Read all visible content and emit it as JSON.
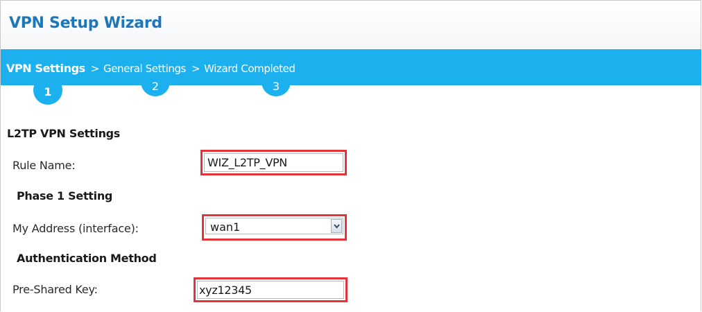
{
  "wizard": {
    "title": "VPN Setup Wizard"
  },
  "steps": {
    "items": [
      {
        "label": "VPN Settings",
        "number": "1",
        "active": true
      },
      {
        "label": "General Settings",
        "number": "2",
        "active": false
      },
      {
        "label": "Wizard Completed",
        "number": "3",
        "active": false
      }
    ],
    "separator": ">"
  },
  "form": {
    "section_title": "L2TP VPN Settings",
    "rule_name": {
      "label": "Rule Name:",
      "value": "WIZ_L2TP_VPN"
    },
    "phase1": {
      "title": "Phase 1 Setting",
      "my_address": {
        "label": "My Address (interface):",
        "value": "wan1"
      }
    },
    "authentication": {
      "title": "Authentication Method",
      "pre_shared_key": {
        "label": "Pre-Shared Key:",
        "value": "xyz12345"
      }
    }
  },
  "colors": {
    "title": "#1d77b9",
    "step_bar": "#1cb1ee",
    "highlight": "#e3343a"
  },
  "icons": {
    "dropdown": "chevron-down-icon"
  }
}
